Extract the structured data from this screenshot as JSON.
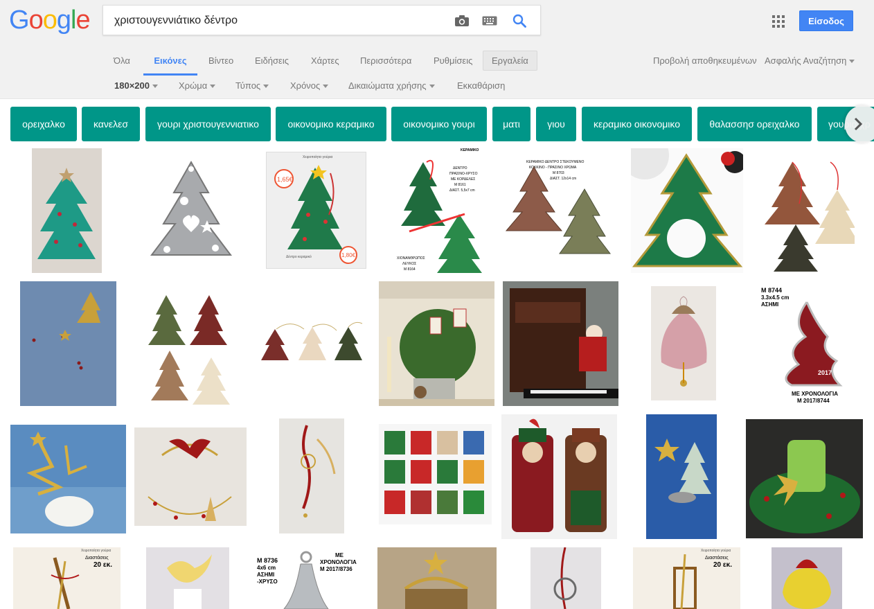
{
  "logo": {
    "letters": [
      "G",
      "o",
      "o",
      "g",
      "l",
      "e"
    ],
    "colors": [
      "#4285f4",
      "#ea4335",
      "#fbbc05",
      "#4285f4",
      "#34a853",
      "#ea4335"
    ]
  },
  "search": {
    "query": "χριστουγεννιάτικο δέντρο",
    "camera_icon": "camera-icon",
    "keyboard_icon": "keyboard-icon",
    "search_icon": "magnifier-icon"
  },
  "header": {
    "signin_label": "Είσοδος",
    "apps_icon": "apps-grid-icon"
  },
  "tabs": [
    {
      "label": "Όλα"
    },
    {
      "label": "Εικόνες",
      "active": true
    },
    {
      "label": "Βίντεο"
    },
    {
      "label": "Ειδήσεις"
    },
    {
      "label": "Χάρτες"
    },
    {
      "label": "Περισσότερα"
    },
    {
      "label": "Ρυθμίσεις"
    },
    {
      "label": "Εργαλεία"
    }
  ],
  "right_links": {
    "saved": "Προβολή αποθηκευμένων",
    "safe_search": "Ασφαλής Αναζήτηση"
  },
  "tools": {
    "size": "180×200",
    "color": "Χρώμα",
    "type": "Τύπος",
    "time": "Χρόνος",
    "rights": "Δικαιώματα χρήσης",
    "clear": "Εκκαθάριση"
  },
  "chips": [
    "ορειχαλκο",
    "κανελεσ",
    "γουρι χριστουγεννιατικο",
    "οικονομικο κεραμικο",
    "οικονομικο γουρι",
    "ματι",
    "γιου",
    "κεραμικο οικονομικο",
    "θαλασσησ ορειχαλκο",
    "γουρια χρ"
  ],
  "thumb_texts": {
    "t1": [
      "Χειροποίητα γούρια",
      "1,65€",
      "Δέντρο κεραμικό",
      "1,80€"
    ],
    "t2": [
      "ΚΕΡΑΜΙΚΟ",
      "ΔΕΝΤΡΟ",
      "ΠΡΑΣΙΝΟ-ΧΡΥΣΟ",
      "ΜΕ ΚΟΡΔΕΛΕΣ",
      "Μ 8161",
      "ΔΙΑΣΤ. 5,5x7 cm",
      "ΧΙΟΝΑΝΘΡΩΠΟΣ",
      "ΛΕΥΚΟΣ",
      "Μ 8164"
    ],
    "t3": [
      "ΚΕΡΑΜΙΚΟ ΔΕΝΤΡΟ ΣΤΕΚΟΥΜΕΝΟ",
      "ΚΟΚΚΙΝΟ - ΠΡΑΣΙΝΟ ΧΡΩΜΑ",
      "Μ 8703",
      "ΔΙΑΣΤ. 12x14 cm"
    ],
    "t4": [
      "Μ 8744",
      "3.3x4.5 cm",
      "ΑΣΗΜΙ",
      "ΜΕ ΧΡΟΝΟΛΟΓΙΑ",
      "Μ 2017/8744",
      "2017"
    ],
    "t5": [
      "Χειροποίητα γούρια",
      "Διαστάσεις",
      "20 εκ."
    ],
    "t6": [
      "Μ 8736",
      "4x6 cm",
      "ΑΣΗΜΙ",
      "-ΧΡΥΣΟ",
      "ΜΕ",
      "ΧΡΟΝΟΛΟΓΙΑ",
      "Μ 2017/8736"
    ],
    "t7": [
      "Χειροποίητα γούρια",
      "Διαστάσεις",
      "20 εκ."
    ]
  },
  "colors": {
    "chip": "#009688",
    "accent": "#4285f4",
    "header_bg": "#f1f1f1"
  }
}
